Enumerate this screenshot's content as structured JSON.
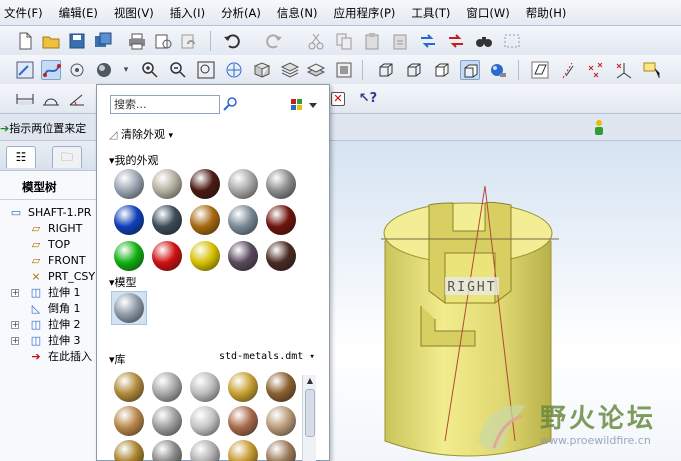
{
  "menubar": {
    "items": [
      "文件(F)",
      "编辑(E)",
      "视图(V)",
      "插入(I)",
      "分析(A)",
      "信息(N)",
      "应用程序(P)",
      "工具(T)",
      "窗口(W)",
      "帮助(H)"
    ]
  },
  "statusbar": {
    "prompt": "指示两位置来定"
  },
  "navigator": {
    "title": "模型树",
    "items": [
      {
        "label": "SHAFT-1.PR",
        "icon": "part-icon"
      },
      {
        "label": "RIGHT",
        "icon": "datum-plane-icon"
      },
      {
        "label": "TOP",
        "icon": "datum-plane-icon"
      },
      {
        "label": "FRONT",
        "icon": "datum-plane-icon"
      },
      {
        "label": "PRT_CSY",
        "icon": "coordinate-system-icon"
      },
      {
        "label": "拉伸 1",
        "icon": "extrude-icon"
      },
      {
        "label": "倒角 1",
        "icon": "chamfer-icon"
      },
      {
        "label": "拉伸 2",
        "icon": "extrude-icon"
      },
      {
        "label": "拉伸 3",
        "icon": "extrude-icon"
      },
      {
        "label": "在此插入",
        "icon": "insert-here-arrow-icon"
      }
    ]
  },
  "gallery": {
    "search_placeholder": "搜索...",
    "clear_label": "清除外观",
    "my_appearances_label": "我的外观",
    "model_label": "模型",
    "library_label": "库",
    "library_file": "std-metals.dmt",
    "my_swatch_colors": [
      [
        "#9aa6b2",
        "#b4b0a0",
        "#4a1a12",
        "#a8a8a8",
        "#8c8c8c"
      ],
      [
        "#0d3fb8",
        "#3a4c5a",
        "#a66a10",
        "#7a8a96",
        "#6e140c"
      ],
      [
        "#10b010",
        "#d01010",
        "#d6c000",
        "#5a4a5e",
        "#4a2a22"
      ]
    ],
    "model_swatch_color": "#8e9aa6",
    "library_swatch_colors": [
      [
        "#b08a3a",
        "#a8a8a8",
        "#bcbcbc",
        "#c8a030",
        "#8a6030"
      ],
      [
        "#b8864a",
        "#9e9e9e",
        "#c4c4c4",
        "#a86a4a",
        "#b89a78"
      ],
      [
        "#a8842e",
        "#8a8a8a",
        "#b0b0b0",
        "#c89a30",
        "#9a7a5a"
      ]
    ]
  },
  "viewport": {
    "datum_label": "RIGHT"
  },
  "watermark": {
    "title": "野火论坛",
    "url": "www.proewildfire.cn"
  }
}
